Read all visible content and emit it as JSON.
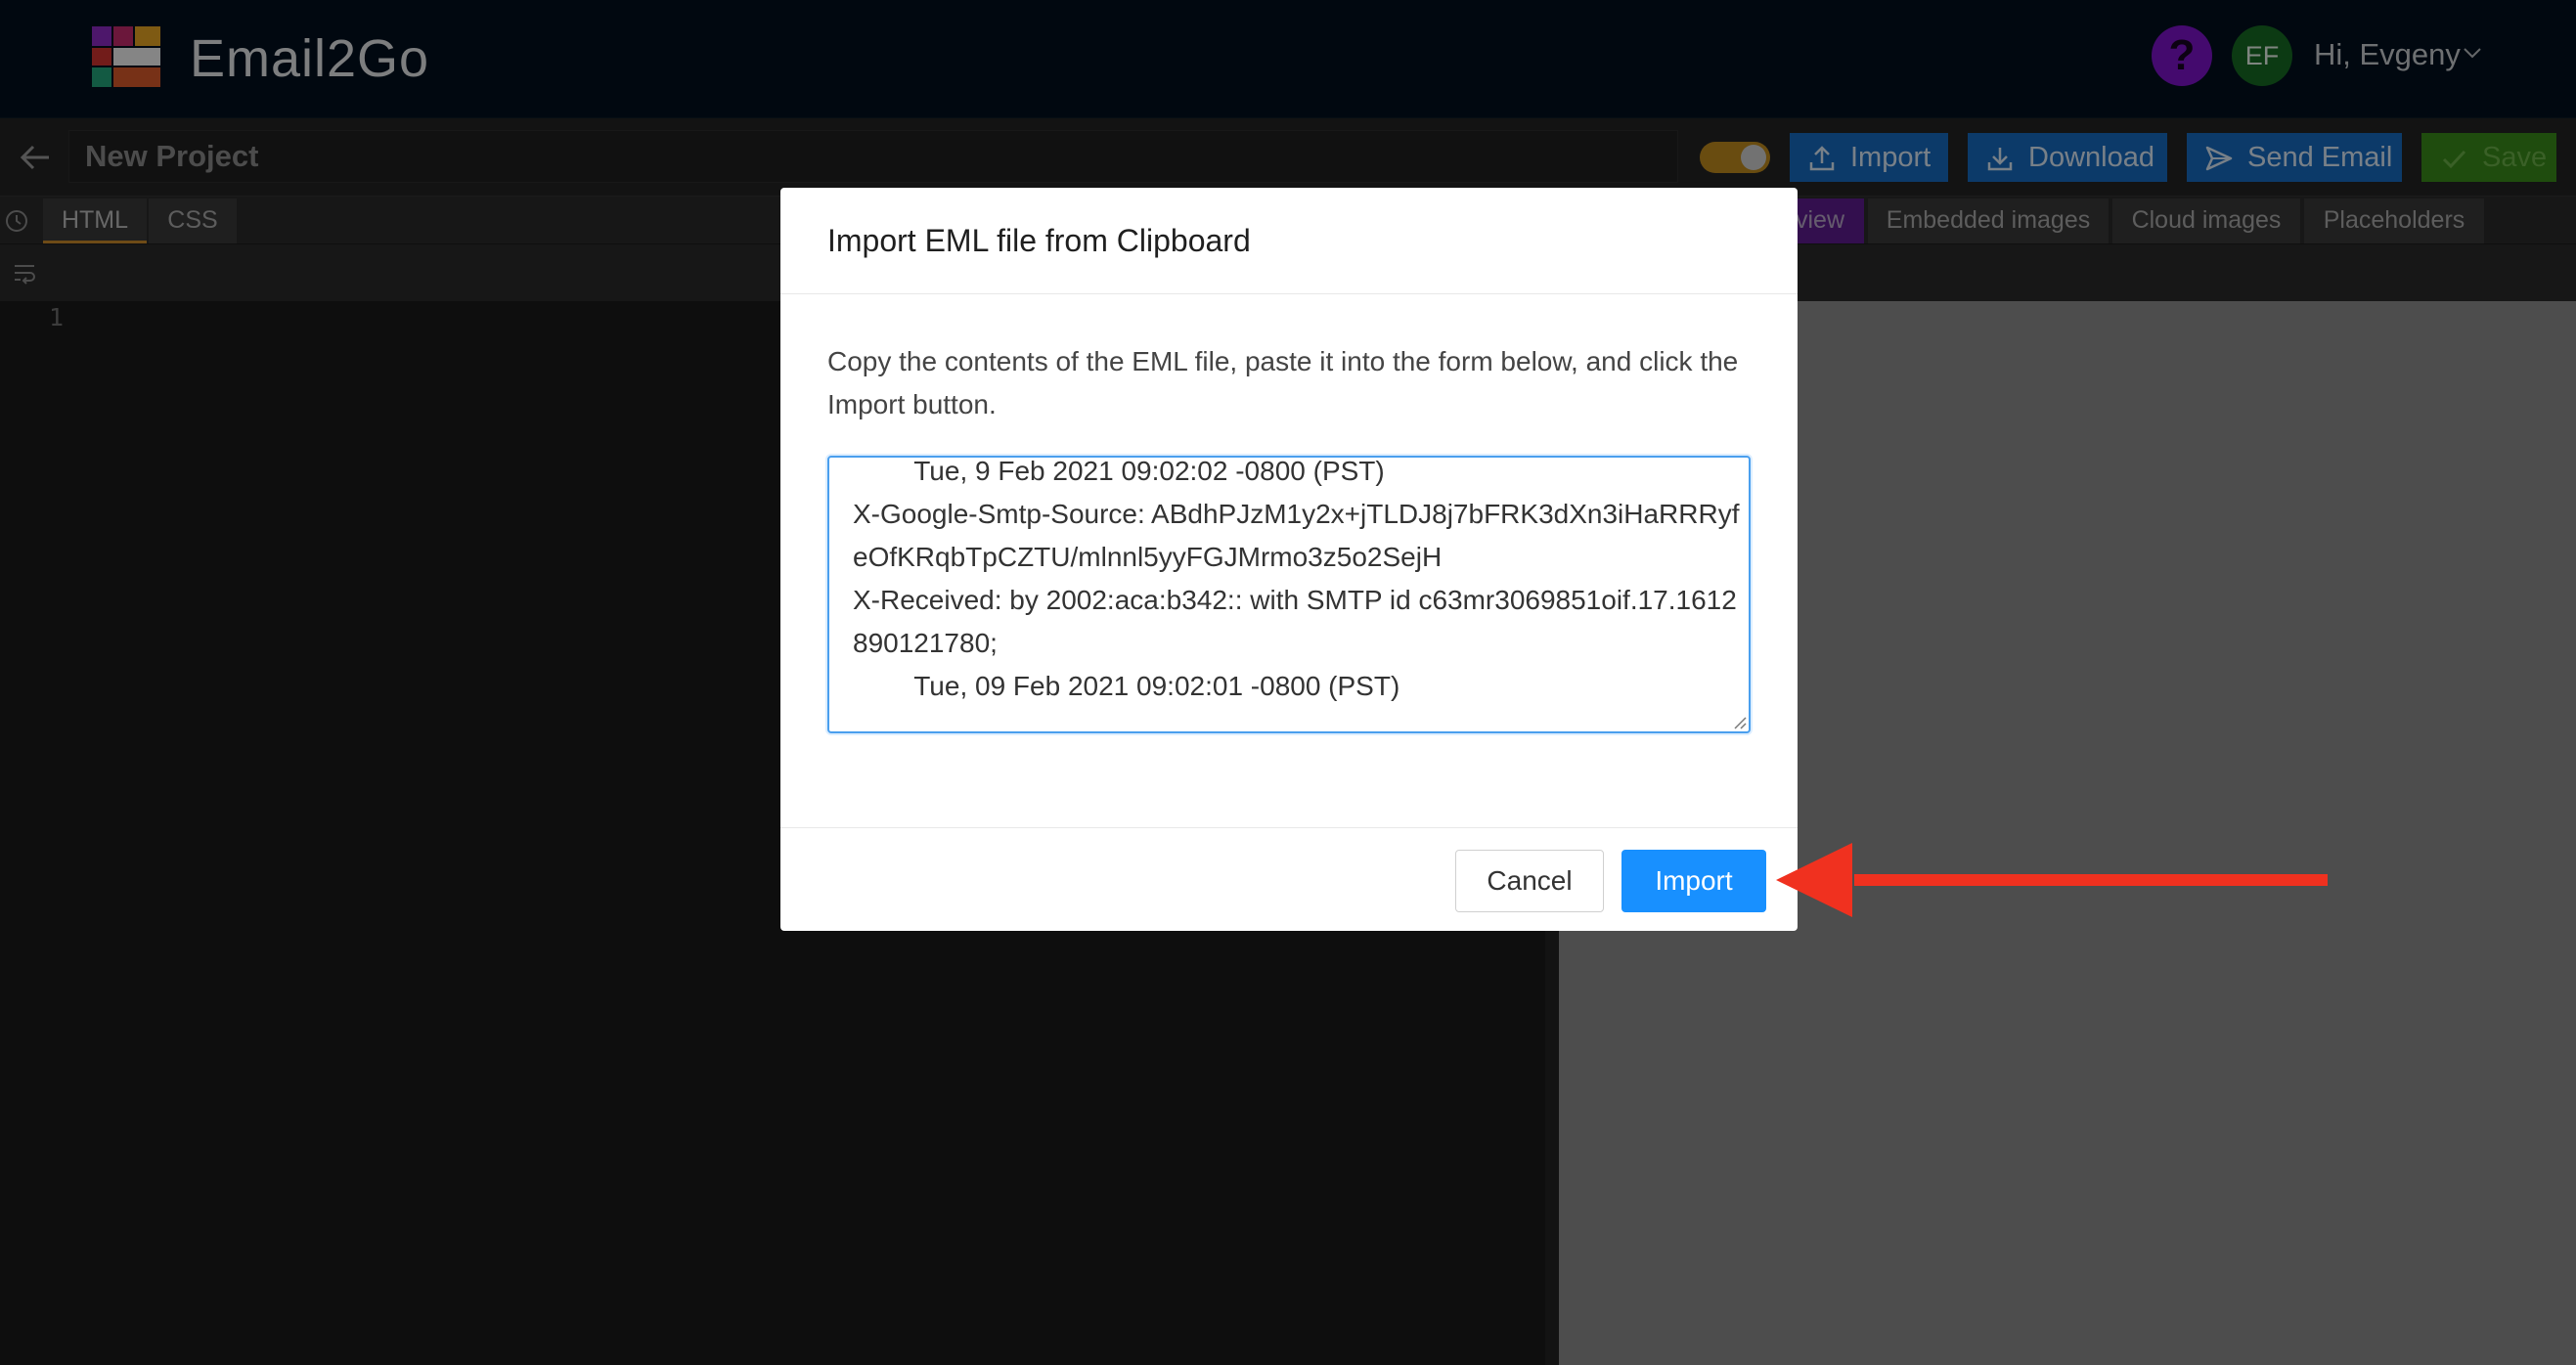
{
  "header": {
    "app_name": "Email2Go",
    "help_symbol": "?",
    "avatar_initials": "EF",
    "greeting": "Hi, Evgeny"
  },
  "toolbar": {
    "project_name": "New Project",
    "import_label": "Import",
    "download_label": "Download",
    "send_label": "Send Email",
    "save_label": "Save"
  },
  "editor_tabs": [
    "HTML",
    "CSS"
  ],
  "preview_tabs": [
    "view",
    "Embedded images",
    "Cloud images",
    "Placeholders"
  ],
  "editor": {
    "line_number": "1"
  },
  "modal": {
    "title": "Import EML file from Clipboard",
    "description": "Copy the contents of the EML file, paste it into the form below, and click the Import button.",
    "textarea_value": "        Tue, 9 Feb 2021 09:02:02 -0800 (PST)\nX-Google-Smtp-Source: ABdhPJzM1y2x+jTLDJ8j7bFRK3dXn3iHaRRRyfeOfKRqbTpCZTU/mlnnl5yyFGJMrmo3z5o2SejH\nX-Received: by 2002:aca:b342:: with SMTP id c63mr3069851oif.17.1612890121780;\n        Tue, 09 Feb 2021 09:02:01 -0800 (PST)",
    "cancel_label": "Cancel",
    "import_label": "Import"
  },
  "colors": {
    "accent": "#1890ff",
    "toolbar_button": "#176bbf",
    "save_button": "#3a8a1a",
    "annotation_arrow": "#f0311f"
  },
  "icons": [
    "back-arrow-icon",
    "moon-icon",
    "upload-icon",
    "download-icon",
    "send-icon",
    "check-icon",
    "history-icon",
    "wrap-lines-icon",
    "chevron-down-icon"
  ]
}
